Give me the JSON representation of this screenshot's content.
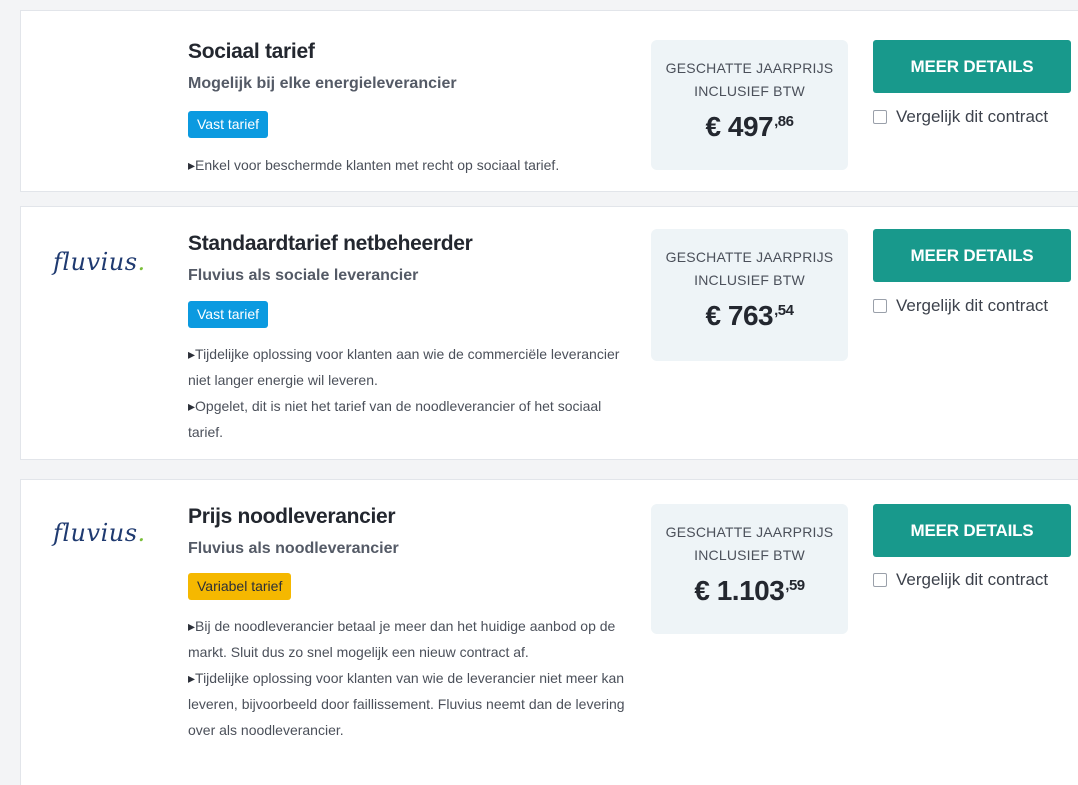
{
  "price_label_line1": "GESCHATTE JAARPRIJS",
  "price_label_line2": "INCLUSIEF BTW",
  "button_label": "MEER DETAILS",
  "compare_label": "Vergelijk dit contract",
  "colors": {
    "button": "#18998c",
    "tag_fixed": "#0b9ae0",
    "tag_variable": "#f5b800",
    "price_box": "#eef4f7",
    "logo": "#1f3a70"
  },
  "contracts": [
    {
      "logo": "",
      "title": "Sociaal tarief",
      "subtitle": "Mogelijk bij elke energieleverancier",
      "tag": "Vast tarief",
      "notes": [
        "Enkel voor beschermde klanten met recht op sociaal tarief."
      ],
      "price_main": "€ 497",
      "price_cents": ",86"
    },
    {
      "logo": "fluvius",
      "logo_dot": ".",
      "title": "Standaardtarief netbeheerder",
      "subtitle": "Fluvius als sociale leverancier",
      "tag": "Vast tarief",
      "notes": [
        "Tijdelijke oplossing voor klanten aan wie de commerciële leverancier niet langer energie wil leveren.",
        "Opgelet, dit is niet het tarief van de noodleverancier of het sociaal tarief."
      ],
      "price_main": "€ 763",
      "price_cents": ",54"
    },
    {
      "logo": "fluvius",
      "logo_dot": ".",
      "title": "Prijs noodleverancier",
      "subtitle": "Fluvius als noodleverancier",
      "tag": "Variabel tarief",
      "notes": [
        "Bij de noodleverancier betaal je meer dan het huidige aanbod op de markt. Sluit dus zo snel mogelijk een nieuw contract af.",
        "Tijdelijke oplossing voor klanten van wie de leverancier niet meer kan leveren, bijvoorbeeld door faillissement. Fluvius neemt dan de levering over als noodleverancier."
      ],
      "price_main": "€ 1.103",
      "price_cents": ",59"
    }
  ]
}
